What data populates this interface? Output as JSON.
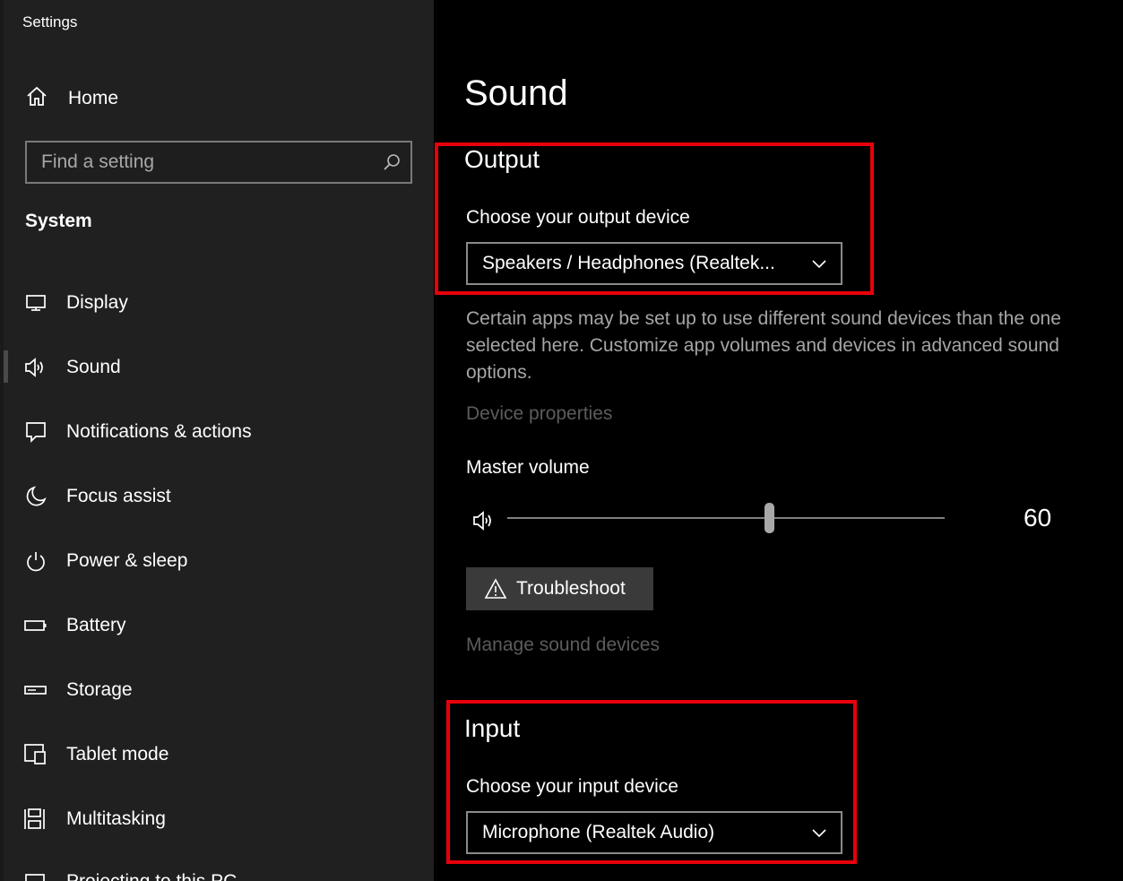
{
  "window": {
    "title": "Settings"
  },
  "sidebar": {
    "home_label": "Home",
    "search_placeholder": "Find a setting",
    "section": "System",
    "items": [
      {
        "label": "Display",
        "icon": "display-icon"
      },
      {
        "label": "Sound",
        "icon": "speaker-icon",
        "selected": true
      },
      {
        "label": "Notifications & actions",
        "icon": "notification-icon"
      },
      {
        "label": "Focus assist",
        "icon": "moon-icon"
      },
      {
        "label": "Power & sleep",
        "icon": "power-icon"
      },
      {
        "label": "Battery",
        "icon": "battery-icon"
      },
      {
        "label": "Storage",
        "icon": "storage-icon"
      },
      {
        "label": "Tablet mode",
        "icon": "tablet-mode-icon"
      },
      {
        "label": "Multitasking",
        "icon": "multitasking-icon"
      },
      {
        "label": "Projecting to this PC",
        "icon": "projecting-icon"
      }
    ]
  },
  "main": {
    "title": "Sound",
    "output": {
      "heading": "Output",
      "device_label": "Choose your output device",
      "device_value": "Speakers / Headphones (Realtek...",
      "description": "Certain apps may be set up to use different sound devices than the one selected here. Customize app volumes and devices in advanced sound options.",
      "device_properties_link": "Device properties",
      "master_volume_label": "Master volume",
      "volume_value": "60",
      "volume_level": 0.6,
      "troubleshoot_label": "Troubleshoot",
      "manage_devices_link": "Manage sound devices"
    },
    "input": {
      "heading": "Input",
      "device_label": "Choose your input device",
      "device_value": "Microphone (Realtek Audio)"
    }
  },
  "colors": {
    "sidebar_bg": "#202020",
    "main_bg": "#000000",
    "highlight_box": "#e8000b",
    "disabled_link": "#5c5c5c"
  }
}
